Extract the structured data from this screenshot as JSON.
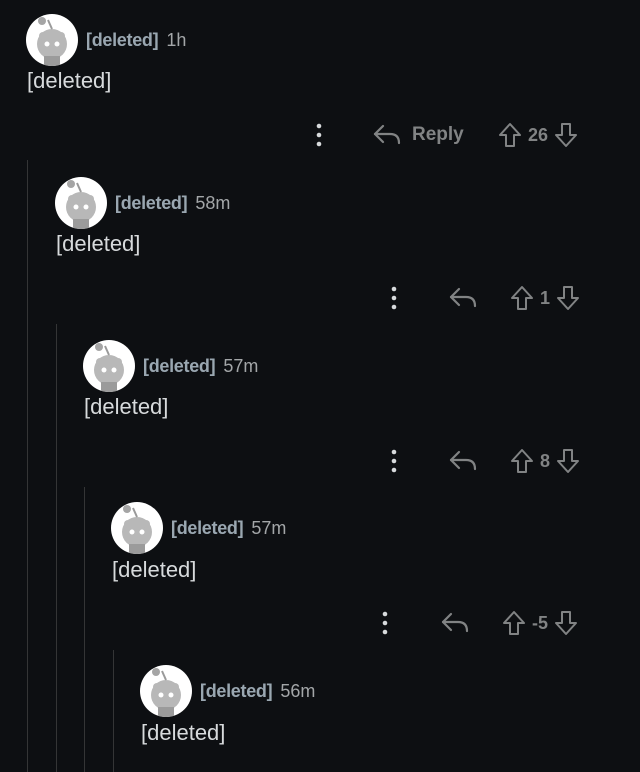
{
  "comments": [
    {
      "author": "[deleted]",
      "age": "1h",
      "body": "[deleted]",
      "score": "26",
      "reply_label": "Reply"
    },
    {
      "author": "[deleted]",
      "age": "58m",
      "body": "[deleted]",
      "score": "1"
    },
    {
      "author": "[deleted]",
      "age": "57m",
      "body": "[deleted]",
      "score": "8"
    },
    {
      "author": "[deleted]",
      "age": "57m",
      "body": "[deleted]",
      "score": "-5"
    },
    {
      "author": "[deleted]",
      "age": "56m",
      "body": "[deleted]"
    }
  ],
  "icons": {
    "avatar": "snoo-avatar-icon",
    "more": "more-options-icon",
    "reply": "reply-arrow-icon",
    "upvote": "upvote-icon",
    "downvote": "downvote-icon"
  },
  "colors": {
    "background": "#0d0f12",
    "author": "#9aa7b1",
    "muted": "#818384",
    "thread_line": "#343536"
  }
}
